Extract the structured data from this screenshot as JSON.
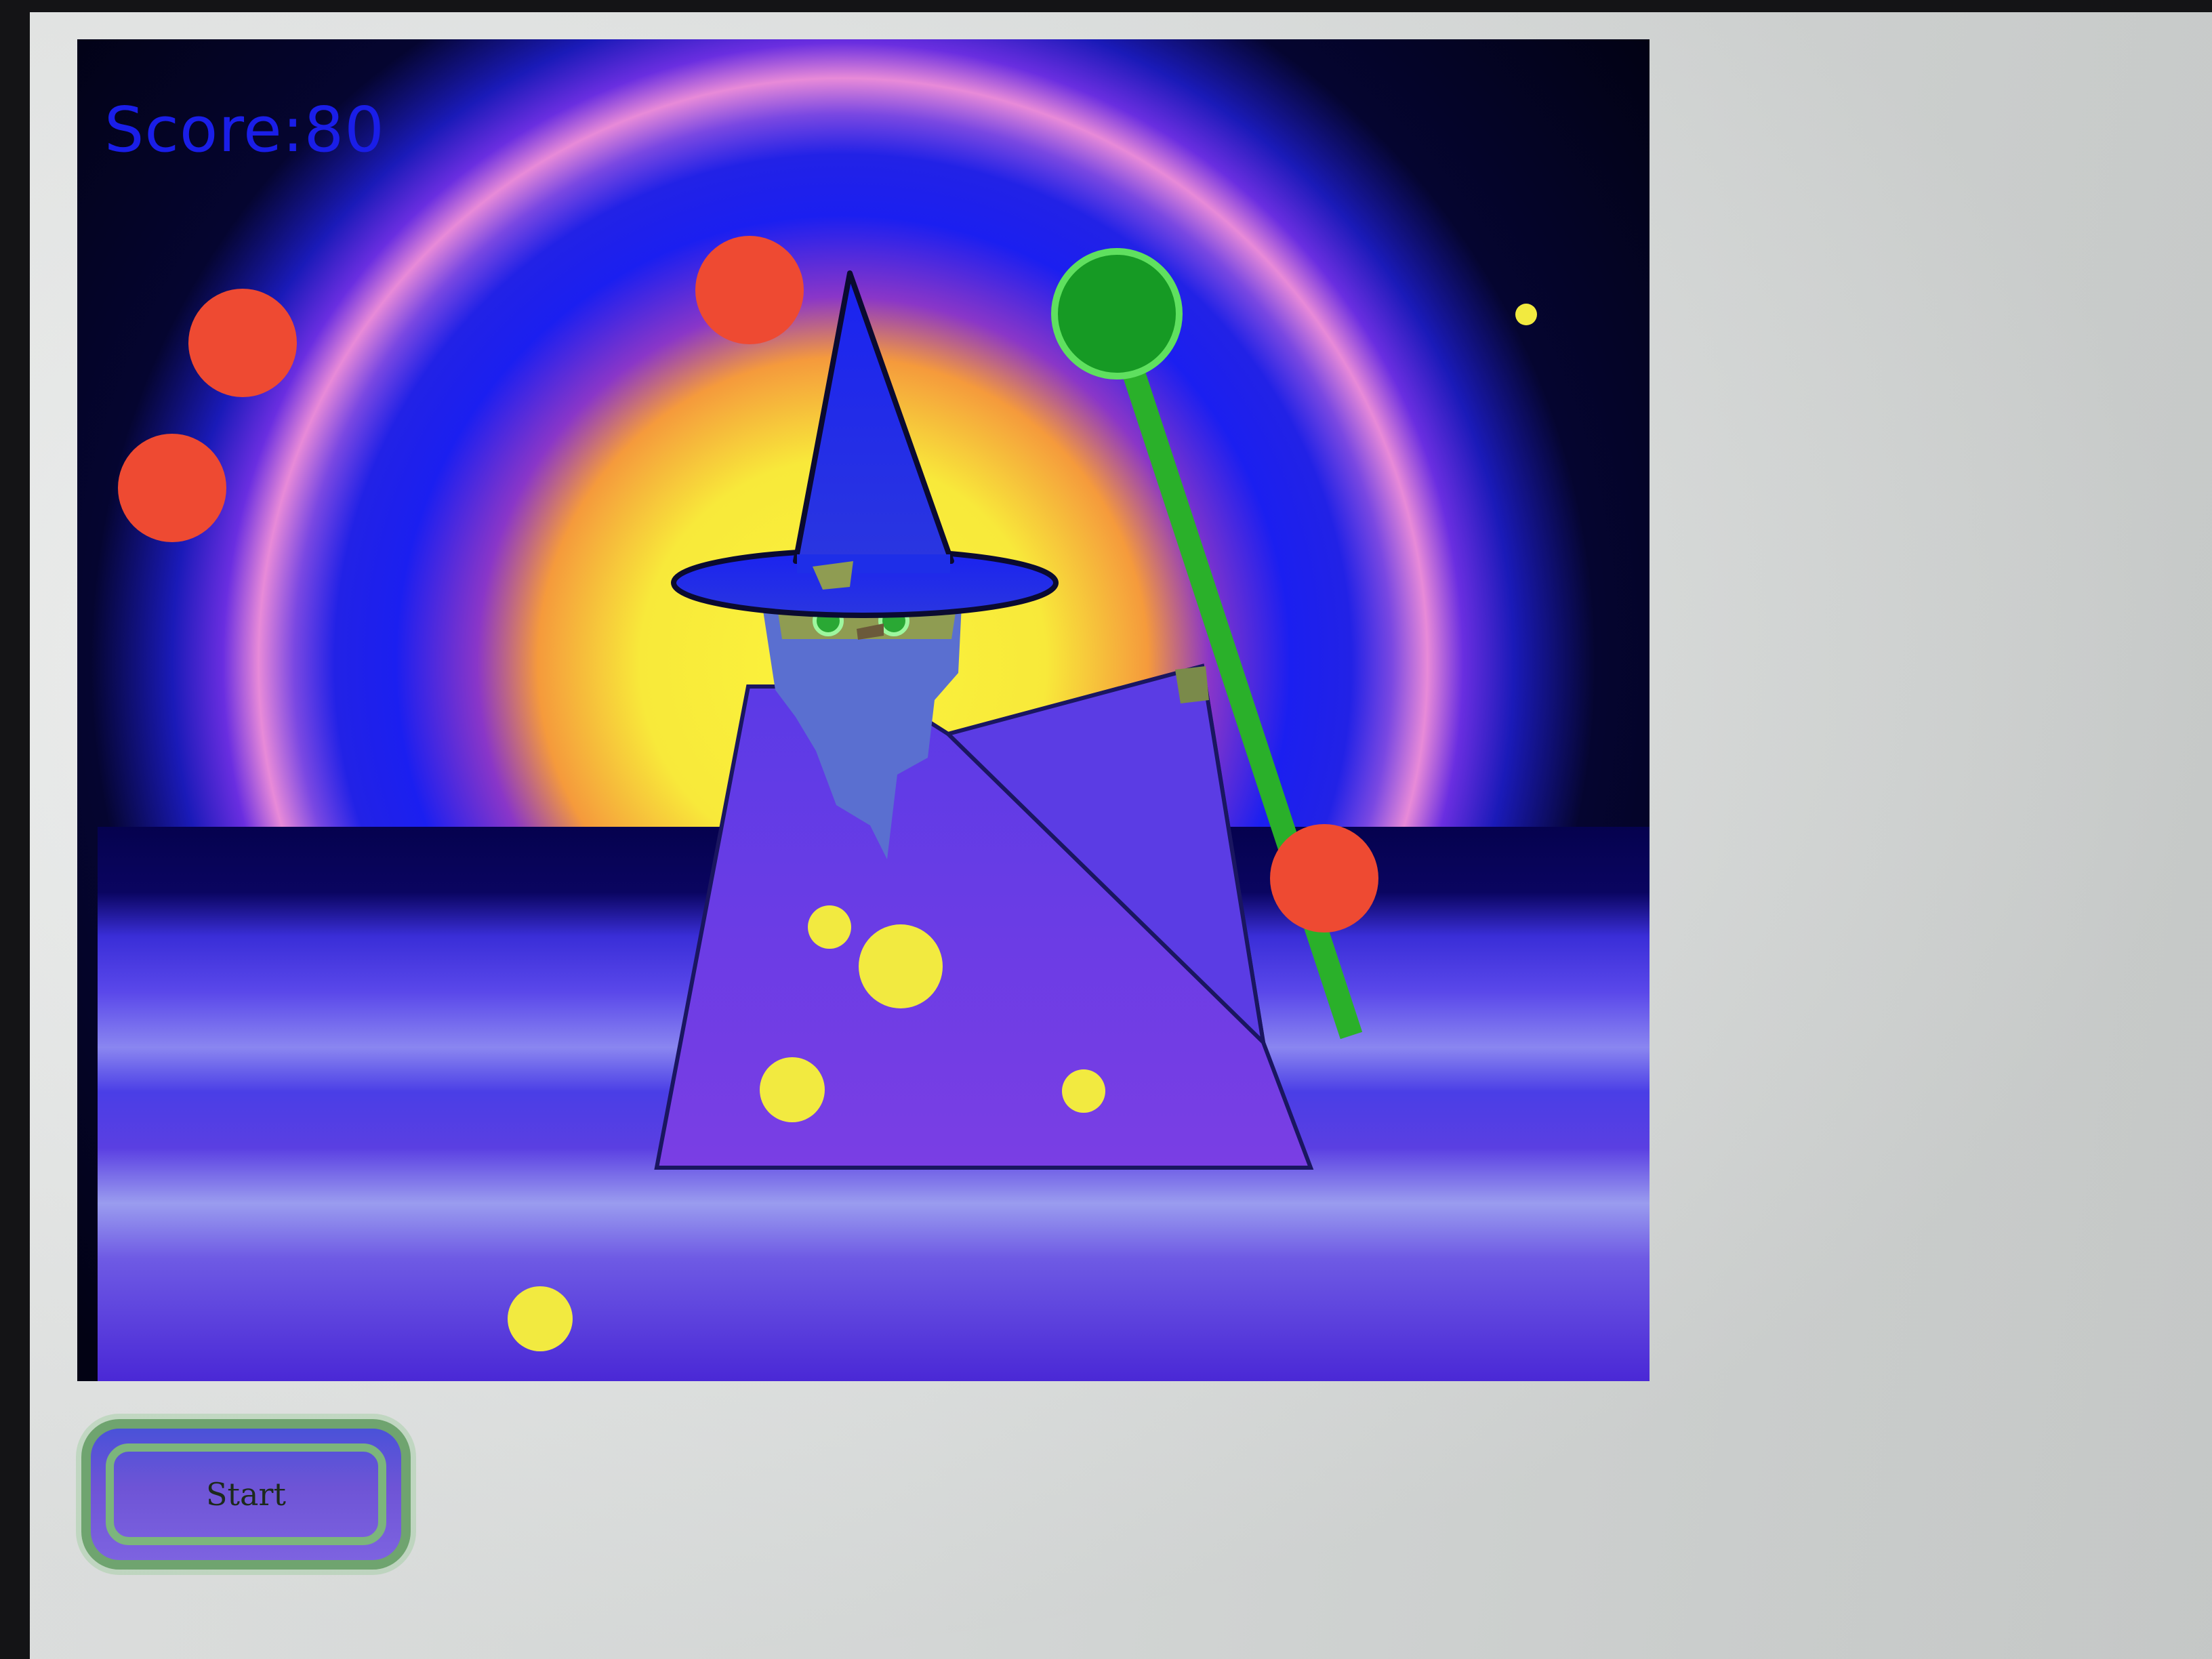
{
  "game": {
    "score_label": "Score:80",
    "start_label": "Start"
  },
  "colors": {
    "score_text": "#1a1ee8",
    "sun_core": "#f8ef3a",
    "sky_outer": "#02021a",
    "halo_blue": "#1b1ff0",
    "halo_pink": "#e27ed8",
    "ground": "#5534e0",
    "robe": "#6a3ee6",
    "hat": "#1e2ee8",
    "beard": "#5a6fd0",
    "face": "#8f9c52",
    "staff": "#2ab02a",
    "staff_orb": "#169a24",
    "fireball": "#ee4a32",
    "star": "#f2ea40",
    "button_border": "#6fa46f"
  },
  "icons": {
    "enemy": "red-fireball",
    "collectible": "yellow-star-dot",
    "player": "wizard-with-staff"
  }
}
